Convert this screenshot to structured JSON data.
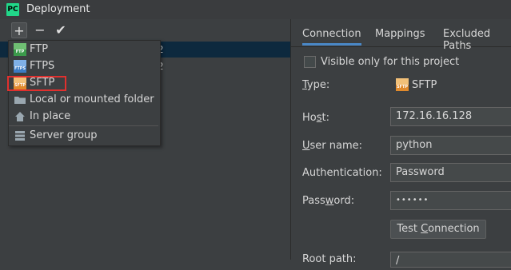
{
  "window": {
    "app_badge": "PC",
    "title": "Deployment"
  },
  "toolbar": {
    "add": "+",
    "remove": "−",
    "apply": "✔"
  },
  "server_list": {
    "row_tail_1": "2",
    "row_tail_2": "2"
  },
  "popup": {
    "items": [
      {
        "label": "FTP",
        "icon": "ftp-icon",
        "badge": "FTP",
        "color": "#3b9a4b"
      },
      {
        "label": "FTPS",
        "icon": "ftps-icon",
        "badge": "FTPS",
        "color": "#3c7cc4"
      },
      {
        "label": "SFTP",
        "icon": "sftp-icon",
        "badge": "SFTP",
        "color": "#e08a2c"
      },
      {
        "label": "Local or mounted folder",
        "icon": "folder-icon"
      },
      {
        "label": "In place",
        "icon": "home-icon"
      },
      {
        "label": "Server group",
        "icon": "server-group-icon"
      }
    ]
  },
  "tabs": [
    {
      "label": "Connection",
      "active": true
    },
    {
      "label": "Mappings",
      "active": false
    },
    {
      "label": "Excluded Paths",
      "active": false
    }
  ],
  "form": {
    "visible_only": {
      "label": "Visible only for this project",
      "checked": false
    },
    "type": {
      "label_u": "T",
      "label_rest": "ype:",
      "value": "SFTP"
    },
    "host": {
      "label_pre": "Ho",
      "label_u": "s",
      "label_rest": "t:",
      "value": "172.16.16.128"
    },
    "user": {
      "label_u": "U",
      "label_rest": "ser name:",
      "value": "python"
    },
    "auth": {
      "label": "Authentication:",
      "value": "Password"
    },
    "password": {
      "label_pre": "Pass",
      "label_u": "w",
      "label_rest": "ord:",
      "value": "••••••"
    },
    "test_button": {
      "label_pre": "Test ",
      "label_u": "C",
      "label_rest": "onnection"
    },
    "root_path": {
      "label": "Root path:",
      "value": "/"
    }
  },
  "colors": {
    "accent": "#4a88c7",
    "highlight": "#e0302e",
    "selection": "#0d293e"
  }
}
